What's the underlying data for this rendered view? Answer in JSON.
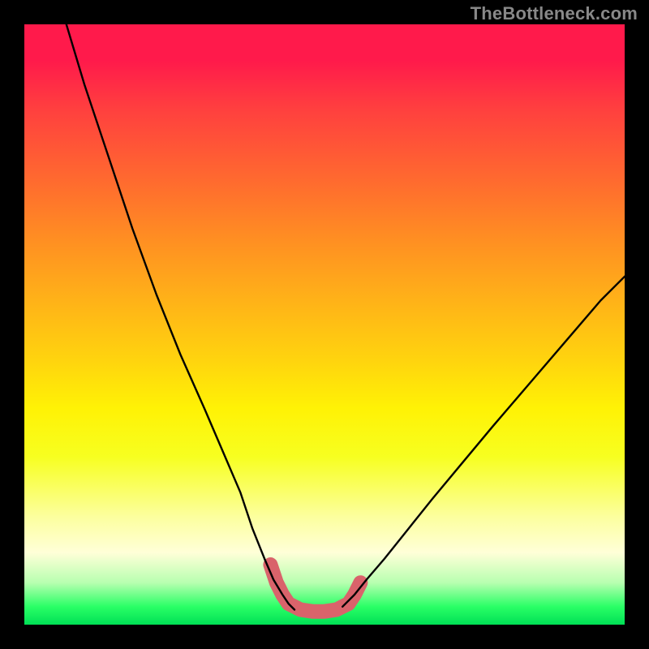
{
  "watermark": "TheBottleneck.com",
  "chart_data": {
    "type": "line",
    "title": "",
    "xlabel": "",
    "ylabel": "",
    "xlim": [
      0,
      100
    ],
    "ylim": [
      0,
      100
    ],
    "series": [
      {
        "name": "left-curve",
        "x": [
          7,
          10,
          14,
          18,
          22,
          26,
          30,
          33,
          36,
          38,
          40,
          41.5,
          43,
          44,
          45
        ],
        "values": [
          100,
          90,
          78,
          66,
          55,
          45,
          36,
          29,
          22,
          16,
          11,
          7.5,
          5,
          3.5,
          2.5
        ]
      },
      {
        "name": "right-curve",
        "x": [
          53,
          55,
          57,
          60,
          64,
          68,
          73,
          78,
          84,
          90,
          96,
          100
        ],
        "values": [
          3,
          5,
          7.5,
          11,
          16,
          21,
          27,
          33,
          40,
          47,
          54,
          58
        ]
      },
      {
        "name": "bottom-band",
        "x": [
          41,
          42,
          43,
          44,
          46,
          48,
          50,
          52,
          54,
          55,
          56
        ],
        "values": [
          10,
          7,
          5,
          3.5,
          2.5,
          2.2,
          2.2,
          2.5,
          3.5,
          5,
          7
        ]
      }
    ],
    "colors": {
      "curve": "#000000",
      "band": "#d9636b"
    }
  }
}
